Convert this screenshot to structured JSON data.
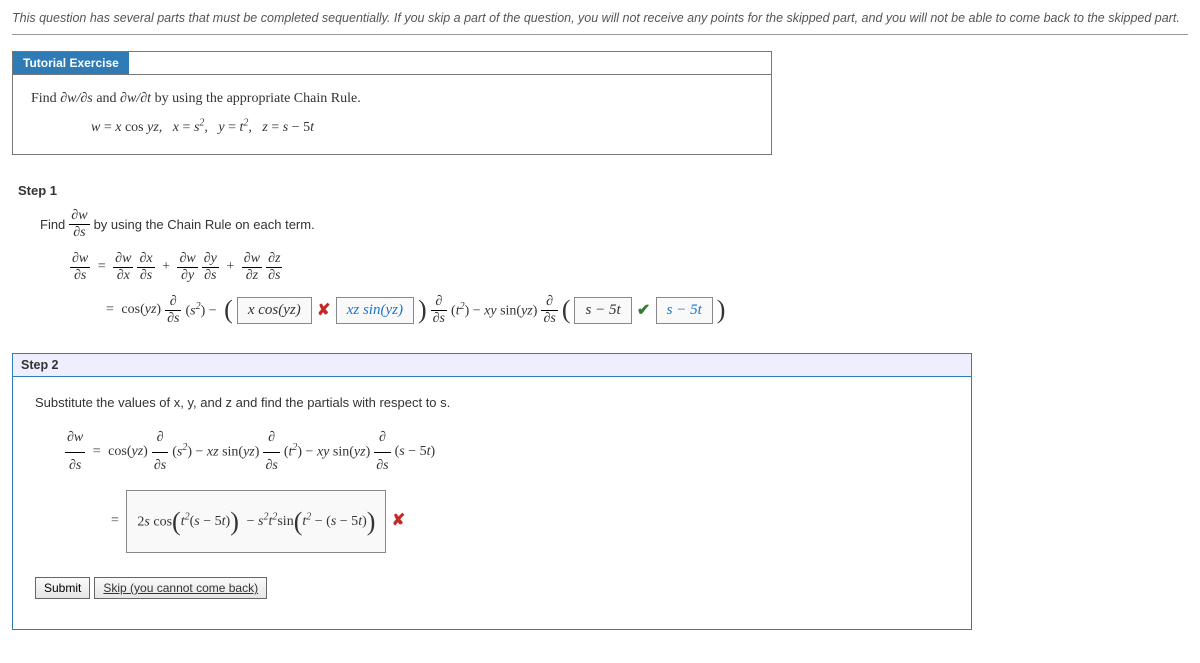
{
  "instruction": "This question has several parts that must be completed sequentially. If you skip a part of the question, you will not receive any points for the skipped part, and you will not be able to come back to the skipped part.",
  "tutorial": {
    "tab": "Tutorial Exercise",
    "line1": "Find ∂w/∂s and ∂w/∂t by using the appropriate Chain Rule.",
    "given": "w = x cos yz,   x = s²,   y = t²,   z = s − 5t"
  },
  "step1": {
    "label": "Step 1",
    "intro_pre": "Find ",
    "intro_post": " by using the Chain Rule on each term.",
    "answer1": "x cos(yz)",
    "answer2": "xz sin(yz)",
    "answer3": "s − 5t",
    "answer4": "s − 5t"
  },
  "step2": {
    "label": "Step 2",
    "intro": "Substitute the values of x, y, and z and find the partials with respect to s.",
    "answer": "2s cos(t²(s − 5t)) − s²t²sin(t² − (s − 5t))"
  },
  "buttons": {
    "submit": "Submit",
    "skip": "Skip (you cannot come back)"
  },
  "marks": {
    "wrong": "✘",
    "right": "✔"
  }
}
